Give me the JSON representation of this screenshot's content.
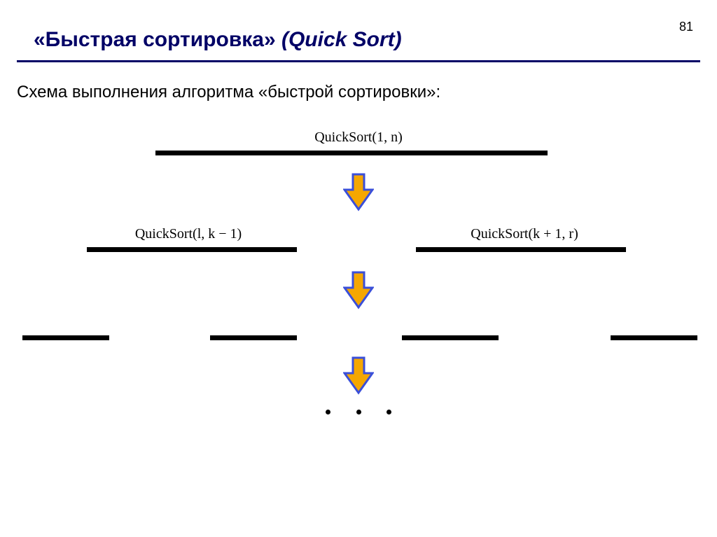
{
  "page_number": "81",
  "title_bold": "«Быстрая сортировка» ",
  "title_italic": "(Quick Sort)",
  "subtitle": "Схема выполнения алгоритма «быстрой сортировки»:",
  "level1_label": "QuickSort(1, n)",
  "level2_left_label": "QuickSort(l, k − 1)",
  "level2_right_label": "QuickSort(k + 1, r)",
  "arrow_fill": "#F5A700",
  "arrow_stroke": "#3A4FD9"
}
